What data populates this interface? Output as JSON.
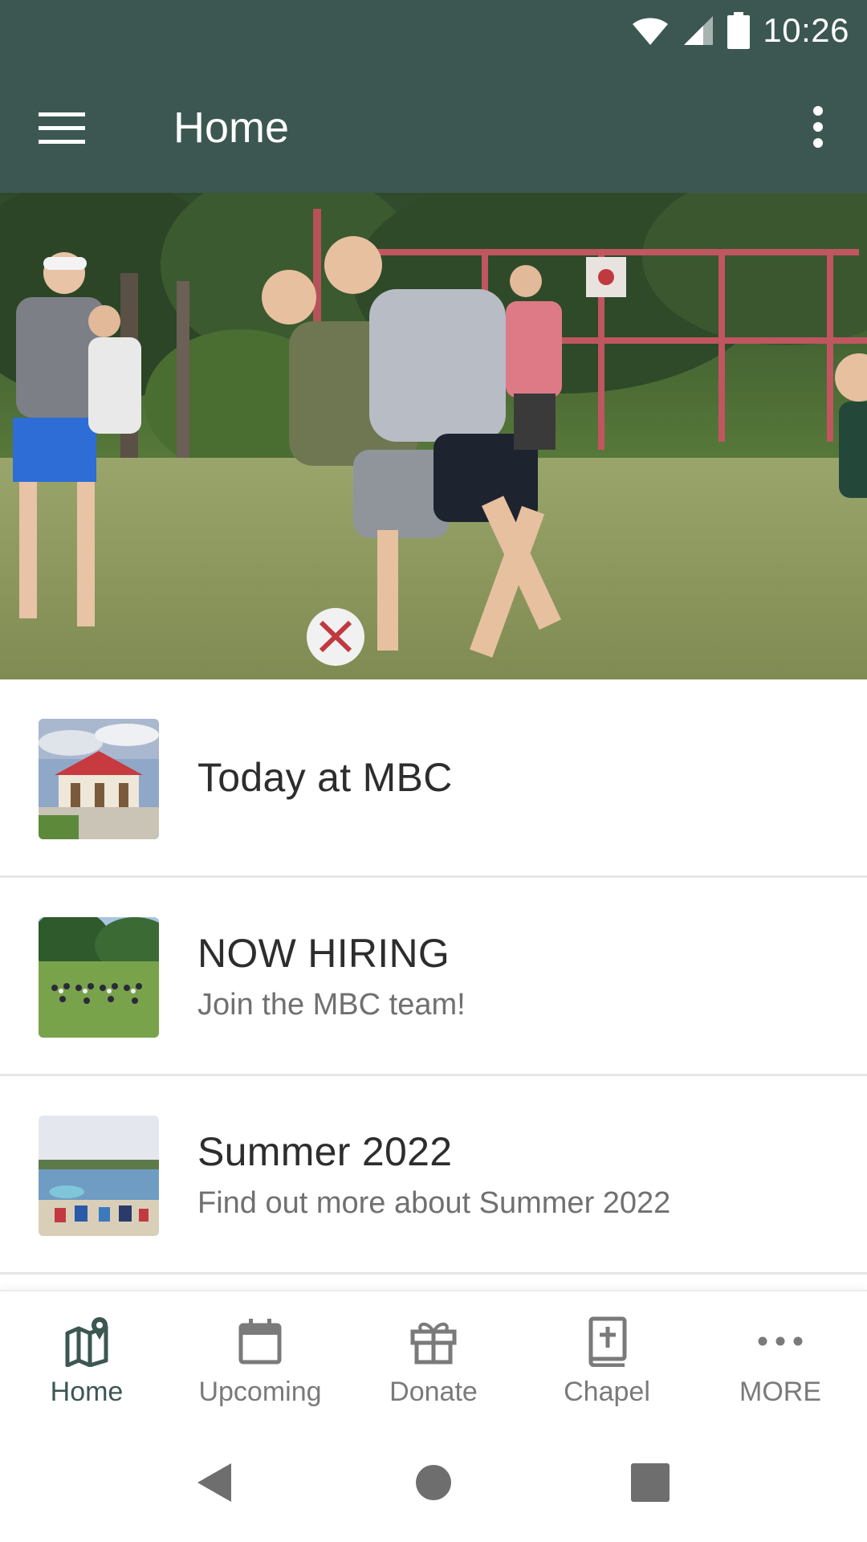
{
  "status_bar": {
    "time": "10:26"
  },
  "app_bar": {
    "title": "Home"
  },
  "carousel": {
    "slide_count": 5,
    "active_index": 0
  },
  "list": [
    {
      "title": "Today at MBC",
      "subtitle": ""
    },
    {
      "title": "NOW HIRING",
      "subtitle": "Join the MBC team!"
    },
    {
      "title": "Summer 2022",
      "subtitle": "Find out more about Summer 2022"
    }
  ],
  "bottom_nav": {
    "items": [
      {
        "label": "Home",
        "icon": "map-pin-icon",
        "active": true
      },
      {
        "label": "Upcoming",
        "icon": "calendar-icon",
        "active": false
      },
      {
        "label": "Donate",
        "icon": "gift-icon",
        "active": false
      },
      {
        "label": "Chapel",
        "icon": "bible-icon",
        "active": false
      },
      {
        "label": "MORE",
        "icon": "more-horizontal-icon",
        "active": false
      }
    ]
  },
  "colors": {
    "primary": "#3c5752",
    "text_primary": "#2d2d2d",
    "text_secondary": "#707070",
    "nav_inactive": "#7a7a7a"
  }
}
